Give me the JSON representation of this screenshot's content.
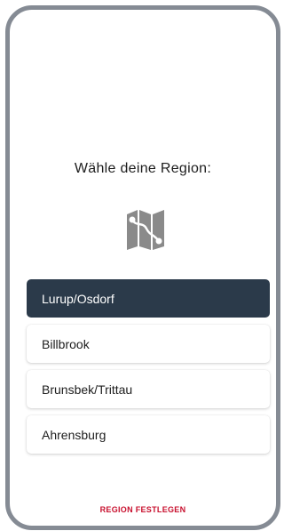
{
  "heading": "Wähle deine Region:",
  "icon": "map-route-icon",
  "regions": [
    {
      "label": "Lurup/Osdorf",
      "selected": true
    },
    {
      "label": "Billbrook",
      "selected": false
    },
    {
      "label": "Brunsbek/Trittau",
      "selected": false
    },
    {
      "label": "Ahrensburg",
      "selected": false
    }
  ],
  "confirm_label": "REGION FESTLEGEN",
  "colors": {
    "selected_bg": "#2b3a4a",
    "accent": "#c8102e",
    "frame": "#858b94",
    "icon": "#8a8a8a"
  }
}
